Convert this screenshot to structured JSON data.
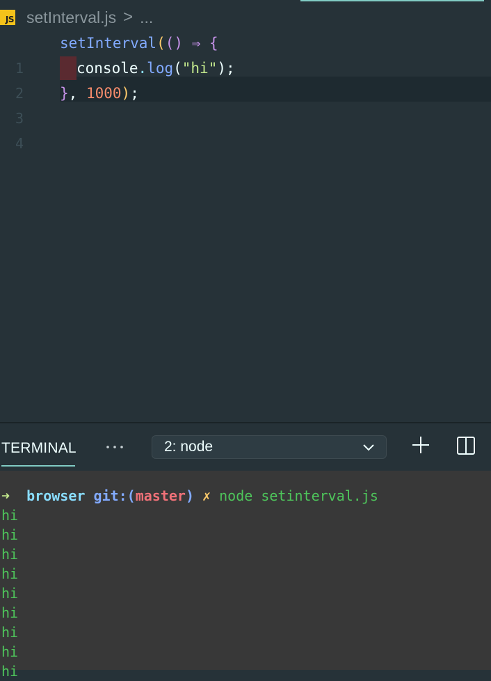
{
  "breadcrumb": {
    "file_icon": "JS",
    "file_name": "setInterval.js",
    "separator": ">",
    "more": "..."
  },
  "editor": {
    "line_numbers": [
      "1",
      "2",
      "3",
      "4"
    ],
    "code": {
      "l1_fn": "setInterval",
      "l1_paren": "(",
      "l1_args": "()",
      "l1_arrow": " ⇒ ",
      "l1_brace": "{",
      "l2_obj": "console",
      "l2_dot": ".",
      "l2_method": "log",
      "l2_open": "(",
      "l2_str": "\"hi\"",
      "l2_close": ");",
      "l3_brace": "}",
      "l3_comma": ", ",
      "l3_num": "1000",
      "l3_paren": ")",
      "l3_semi": ";"
    }
  },
  "panel": {
    "tab_label": "TERMINAL",
    "selected_terminal": "2: node"
  },
  "terminal": {
    "prompt_arrow": "➜",
    "directory": "browser",
    "git_label": "git:(",
    "branch": "master",
    "git_close": ")",
    "dirty_mark": "✗",
    "command": "node setinterval.js",
    "output": [
      "hi",
      "hi",
      "hi",
      "hi",
      "hi",
      "hi",
      "hi",
      "hi",
      "hi"
    ]
  },
  "colors": {
    "editor_bg": "#263238",
    "terminal_bg": "#383838",
    "accent": "#80cbc4",
    "js_icon": "#f4c21b"
  }
}
